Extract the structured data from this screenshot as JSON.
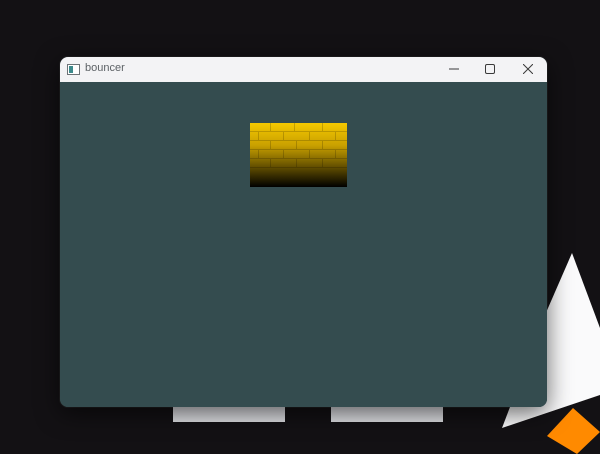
{
  "window": {
    "title": "bouncer"
  },
  "icons": {
    "app": "app-window-icon",
    "minimize": "minimize-icon",
    "maximize": "maximize-icon",
    "close": "close-icon"
  },
  "colors": {
    "desktop": "#131114",
    "client_area": "#344c4f",
    "titlebar": "#f3f3f5",
    "sprite_top": "#f2c200",
    "sprite_bottom": "#000000",
    "accent_orange": "#ff8a00"
  }
}
